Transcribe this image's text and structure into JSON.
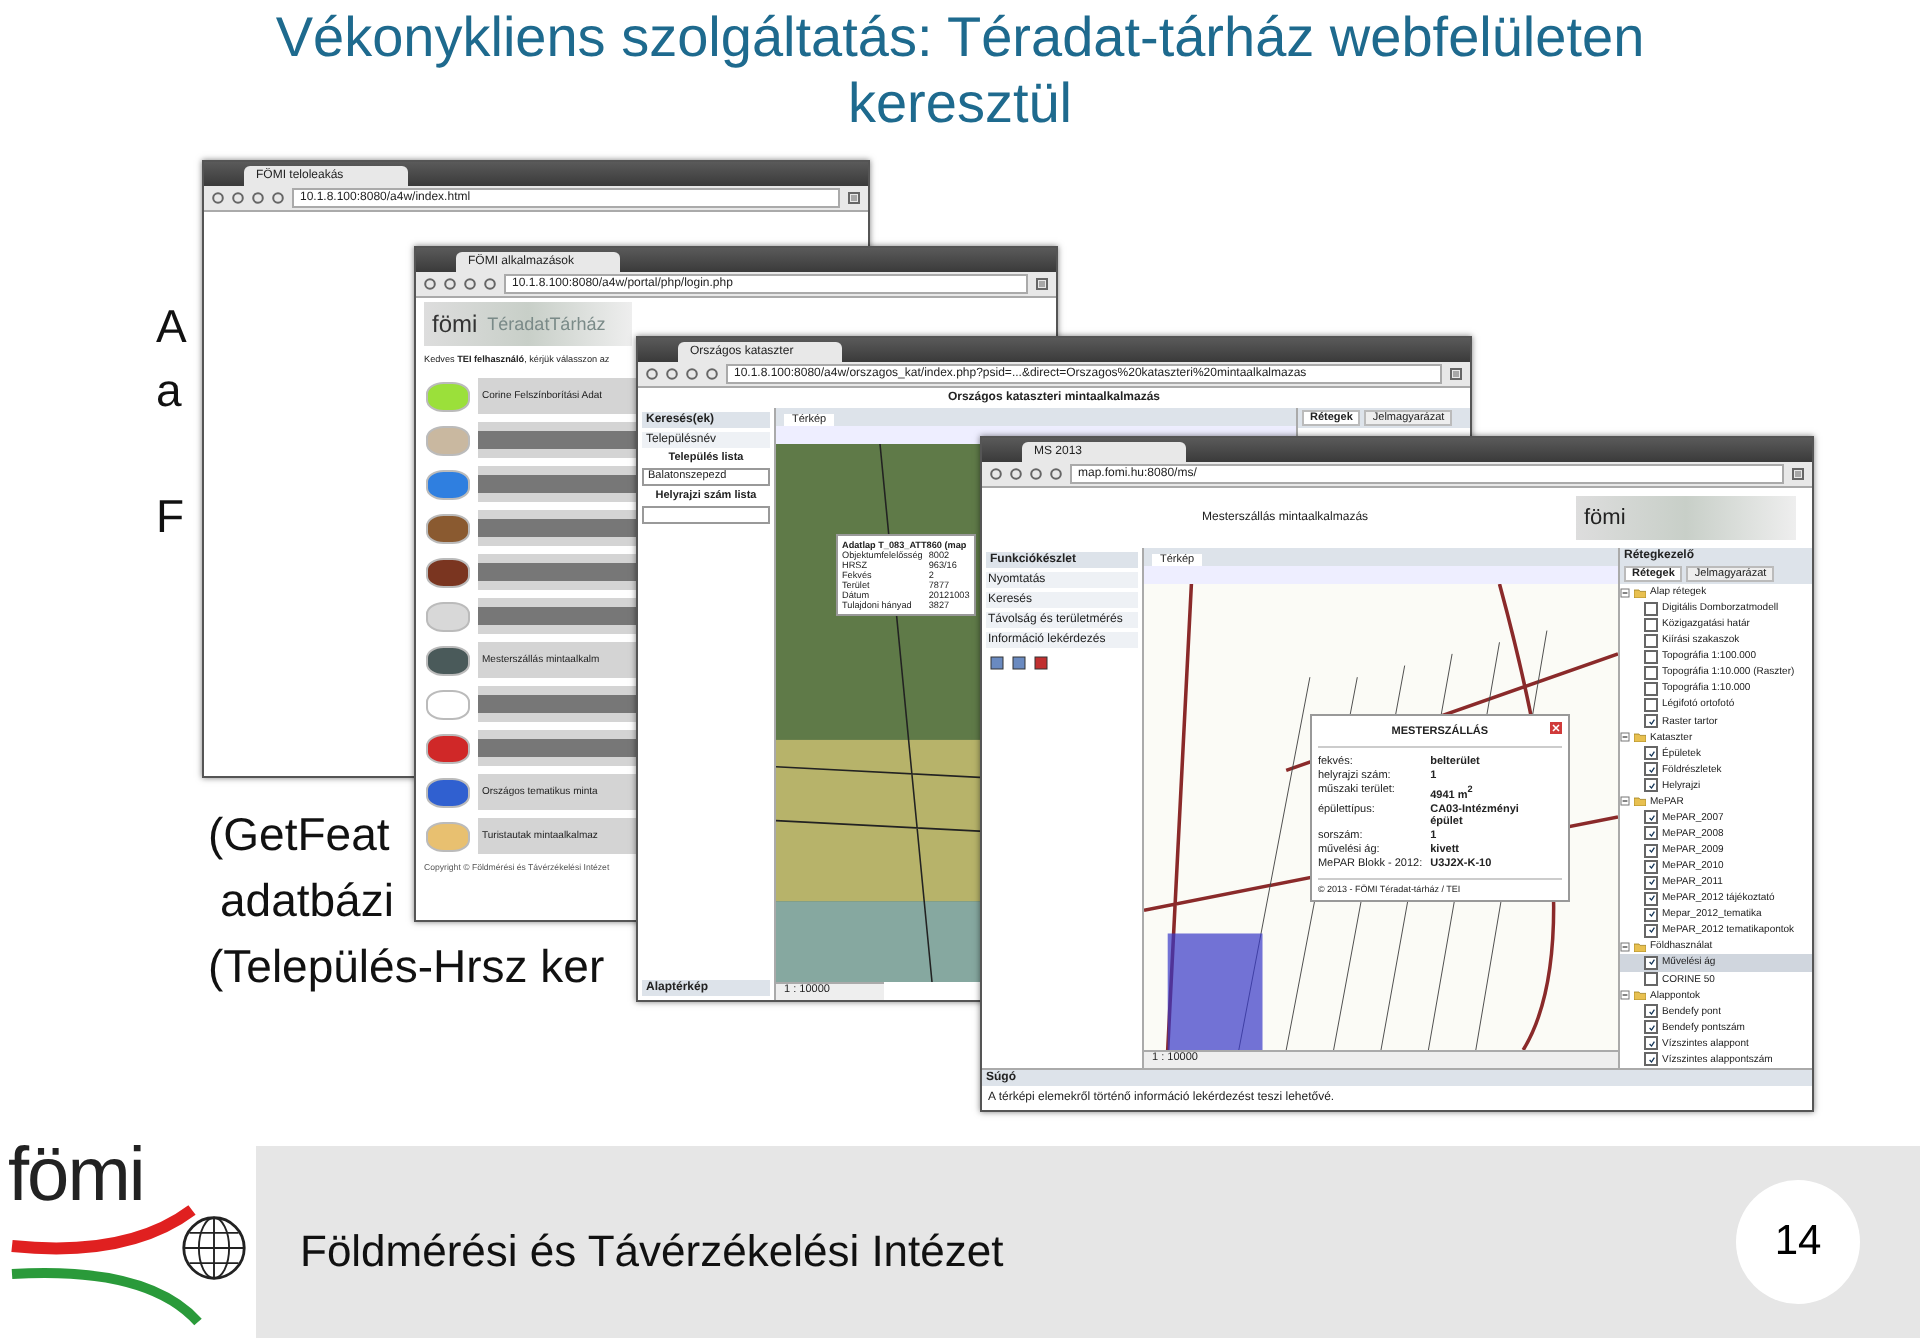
{
  "slide": {
    "title": "Vékonykliens szolgáltatás: Téradat-tárház webfelületen keresztül",
    "body_fragments": [
      "A",
      "a",
      "F",
      "(GetFeat",
      "adatbázi",
      "(Település-Hrsz ker"
    ]
  },
  "windows": [
    {
      "kind": "blank",
      "tab": "FÖMI teloleakás",
      "url": "10.1.8.100:8080/a4w/index.html"
    },
    {
      "kind": "portal",
      "tab": "FÖMI alkalmazások",
      "url": "10.1.8.100:8080/a4w/portal/php/login.php",
      "logo": "fömi",
      "banner": "TéradatTárház",
      "greeting": "Kedves **TEI felhasználó**, kérjük válasszon az",
      "apps": [
        {
          "label": "Corine Felszínborítási Adat",
          "color": "#9be03a"
        },
        {
          "color": "#c9b8a0"
        },
        {
          "color": "#2f7fe0"
        },
        {
          "color": "#8a5a30"
        },
        {
          "color": "#7a3520"
        },
        {
          "color": "#d8d8d8"
        },
        {
          "label": "Mesterszállás mintaalkalm",
          "color": "#4a5a5a"
        },
        {
          "color": "#ffffff"
        },
        {
          "color": "#d02828"
        },
        {
          "label": "Országos tematikus minta",
          "color": "#3060d0"
        },
        {
          "label": "Turistautak mintaalkalmaz",
          "color": "#e8c070"
        }
      ],
      "copyright": "Copyright © Földmérési és Távérzékelési Intézet"
    },
    {
      "kind": "cadastre",
      "tab": "Országos kataszter",
      "url": "10.1.8.100:8080/a4w/orszagos_kat/index.php?psid=...&direct=Orszagos%20kataszteri%20mintaalkalmazas",
      "heading": "Országos kataszteri mintaalkalmazás",
      "panel_title": "Keresés(ek)",
      "panel_section": "Településnév",
      "fields": [
        {
          "label": "Település lista",
          "value": "Balatonszepezd"
        },
        {
          "label": "Helyrajzi szám lista"
        }
      ],
      "map_tab": "Térkép",
      "right_tabs": [
        {
          "label": "Rétegek",
          "selected": true
        },
        {
          "label": "Jelmagyarázat",
          "selected": false
        }
      ],
      "popup": {
        "title": "Adatlap T_083_ATT860 (map",
        "rows": [
          [
            "Objektumfelelősség",
            "8002"
          ],
          [
            "HRSZ",
            "963/16"
          ],
          [
            "Fekvés",
            "2"
          ],
          [
            "Terület",
            "7877"
          ],
          [
            "Dátum",
            "20121003"
          ],
          [
            "Tulajdoni hányad",
            "3827"
          ]
        ]
      },
      "scale": "1 : 10000",
      "bottom_panel": "Alaptérkép"
    },
    {
      "kind": "mesterszallas",
      "tab": "MS 2013",
      "url": "map.fomi.hu:8080/ms/",
      "heading": "Mesterszállás mintaalkalmazás",
      "logo": "fömi",
      "panel_title": "Funkciókészlet",
      "tools": [
        "Nyomtatás",
        "Keresés",
        "Távolság és területmérés",
        "Információ lekérdezés"
      ],
      "map_tab": "Térkép",
      "layers_title": "Rétegkezelő",
      "right_tabs": [
        {
          "label": "Rétegek",
          "selected": true
        },
        {
          "label": "Jelmagyarázat",
          "selected": false
        }
      ],
      "layers": [
        {
          "label": "Alap rétegek",
          "expanded": true,
          "children": [
            {
              "label": "Digitális Domborzatmodell",
              "checked": false
            },
            {
              "label": "Közigazgatási határ",
              "checked": false
            },
            {
              "label": "Kiírási szakaszok",
              "checked": false
            },
            {
              "label": "Topográfia 1:100.000",
              "checked": false
            },
            {
              "label": "Topográfia 1:10.000 (Raszter)",
              "checked": false
            },
            {
              "label": "Topográfia 1:10.000",
              "checked": false
            },
            {
              "label": "Légifotó ortofotó",
              "checked": false
            },
            {
              "label": "Raster tartor",
              "checked": true
            }
          ]
        },
        {
          "label": "Kataszter",
          "expanded": true,
          "children": [
            {
              "label": "Épületek",
              "checked": true
            },
            {
              "label": "Földrészletek",
              "checked": true
            },
            {
              "label": "Helyrajzi",
              "checked": true
            }
          ]
        },
        {
          "label": "MePAR",
          "expanded": true,
          "children": [
            {
              "label": "MePAR_2007",
              "checked": true
            },
            {
              "label": "MePAR_2008",
              "checked": true
            },
            {
              "label": "MePAR_2009",
              "checked": true
            },
            {
              "label": "MePAR_2010",
              "checked": true
            },
            {
              "label": "MePAR_2011",
              "checked": true
            },
            {
              "label": "MePAR_2012 tájékoztató",
              "checked": true
            },
            {
              "label": "Mepar_2012_tematika",
              "checked": true
            },
            {
              "label": "MePAR_2012 tematikapontok",
              "checked": true
            }
          ]
        },
        {
          "label": "Földhasználat",
          "expanded": true,
          "children": [
            {
              "label": "Művelési ág",
              "checked": true,
              "selected": true
            },
            {
              "label": "CORINE 50",
              "checked": false,
              "selected": false
            }
          ]
        },
        {
          "label": "Alappontok",
          "expanded": true,
          "children": [
            {
              "label": "Bendefy pont",
              "checked": true
            },
            {
              "label": "Bendefy pontszám",
              "checked": true
            },
            {
              "label": "Vízszintes alappont",
              "checked": true
            },
            {
              "label": "Vízszintes alappontszám",
              "checked": true
            }
          ]
        }
      ],
      "popup": {
        "title": "MESTERSZÁLLÁS",
        "rows": [
          [
            "fekvés:",
            "belterület"
          ],
          [
            "helyrajzi szám:",
            "1"
          ],
          [
            "műszaki terület:",
            "4941 m$^{2}$"
          ],
          [
            "épülettípus:",
            "CA03-Intézményi épület"
          ],
          [
            "sorszám:",
            "1"
          ],
          [
            "művelési ág:",
            "kivett"
          ],
          [
            "MePAR Blokk - 2012:",
            "U3J2X-K-10"
          ]
        ],
        "footer": "© 2013 - FÖMI Téradat-tárház / TEI"
      },
      "scale": "1 : 10000",
      "help_title": "Súgó",
      "help_text": "A térképi elemekről történő információ lekérdezést teszi lehetővé."
    }
  ],
  "footer": {
    "logo": "fömi",
    "institute": "Földmérési és Távérzékelési Intézet",
    "page_number": "14"
  }
}
